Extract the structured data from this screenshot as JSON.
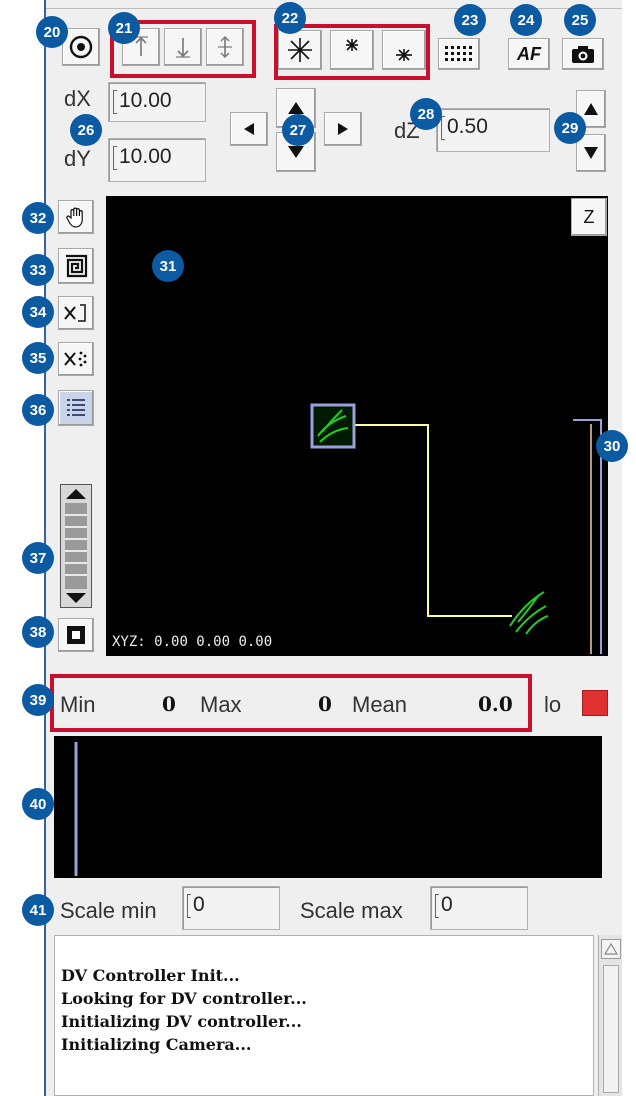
{
  "toolbar": {
    "mark_tool_icon": "target-icon",
    "z_buttons": [
      "arrow-up-icon",
      "arrow-down-icon",
      "center-icon"
    ],
    "focus_buttons": [
      "focus-asterisk-icon",
      "asterisk-top-icon",
      "asterisk-bottom-icon"
    ],
    "grid_icon": "grid-icon",
    "af_label": "AF",
    "camera_icon": "camera-icon"
  },
  "stage": {
    "dx_label": "dX",
    "dx_value": "10.00",
    "dy_label": "dY",
    "dy_value": "10.00",
    "dz_label": "dZ",
    "dz_value": "0.50"
  },
  "tools": [
    "hand-icon",
    "spiral-icon",
    "clear-points-icon",
    "clear-all-icon",
    "list-icon",
    "square-icon"
  ],
  "z_label": "Z",
  "viewer": {
    "xyz_label": "XYZ:",
    "xyz_value": "0.00 0.00 0.00"
  },
  "stats": {
    "min_label": "Min",
    "min_value": "0",
    "max_label": "Max",
    "max_value": "0",
    "mean_label": "Mean",
    "mean_value": "0.0",
    "lo_label": "lo",
    "lo_color": "#e03030"
  },
  "scale": {
    "min_label": "Scale min",
    "min_value": "0",
    "max_label": "Scale max",
    "max_value": "0"
  },
  "console": {
    "lines": [
      "DV Controller Init...",
      "Looking for DV controller...",
      "Initializing DV controller...",
      "Initializing Camera..."
    ]
  },
  "callouts": [
    "20",
    "21",
    "22",
    "23",
    "24",
    "25",
    "26",
    "27",
    "28",
    "29",
    "30",
    "31",
    "32",
    "33",
    "34",
    "35",
    "36",
    "37",
    "38",
    "39",
    "40",
    "41"
  ],
  "colors": {
    "callout": "#0b5aa2",
    "highlight": "#c8102e",
    "path": "#ffff99",
    "cell": "#22cc22"
  }
}
